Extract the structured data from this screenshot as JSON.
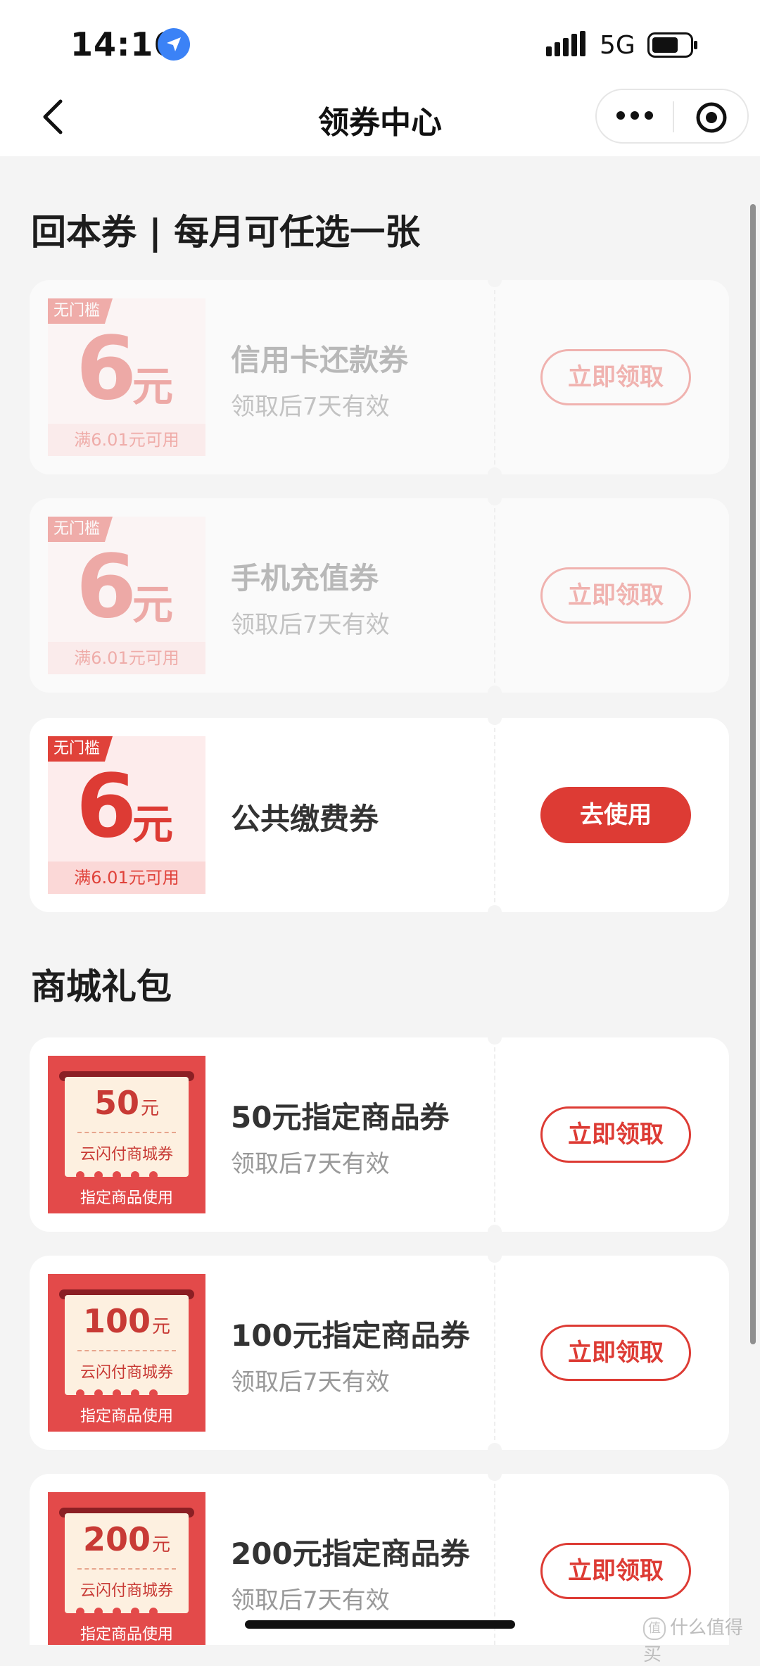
{
  "status": {
    "time": "14:16",
    "network": "5G"
  },
  "nav": {
    "title": "领券中心"
  },
  "sections": [
    {
      "title": "回本券 | 每月可任选一张",
      "coupons": [
        {
          "tag": "无门槛",
          "amount": "6",
          "unit": "元",
          "condition": "满6.01元可用",
          "title": "信用卡还款券",
          "sub": "领取后7天有效",
          "button": "立即领取",
          "state": "disabled"
        },
        {
          "tag": "无门槛",
          "amount": "6",
          "unit": "元",
          "condition": "满6.01元可用",
          "title": "手机充值券",
          "sub": "领取后7天有效",
          "button": "立即领取",
          "state": "disabled"
        },
        {
          "tag": "无门槛",
          "amount": "6",
          "unit": "元",
          "condition": "满6.01元可用",
          "title": "公共缴费券",
          "button": "去使用",
          "state": "active"
        }
      ]
    },
    {
      "title": "商城礼包",
      "coupons": [
        {
          "amount": "50",
          "unit": "元",
          "shop": "云闪付商城券",
          "footer": "指定商品使用",
          "title": "50元指定商品券",
          "sub": "领取后7天有效",
          "button": "立即领取"
        },
        {
          "amount": "100",
          "unit": "元",
          "shop": "云闪付商城券",
          "footer": "指定商品使用",
          "title": "100元指定商品券",
          "sub": "领取后7天有效",
          "button": "立即领取"
        },
        {
          "amount": "200",
          "unit": "元",
          "shop": "云闪付商城券",
          "footer": "指定商品使用",
          "title": "200元指定商品券",
          "sub": "领取后7天有效",
          "button": "立即领取"
        }
      ]
    }
  ],
  "watermark": "什么值得买",
  "colors": {
    "accent": "#dd3b34",
    "background": "#f4f4f4"
  }
}
